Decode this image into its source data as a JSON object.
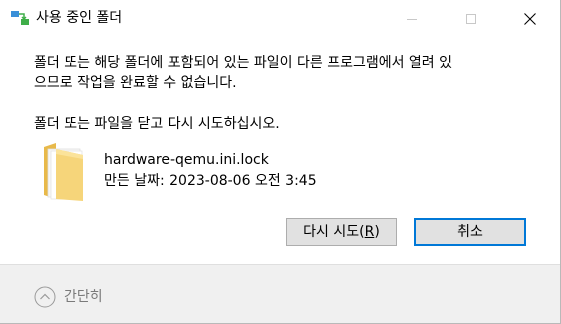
{
  "window": {
    "title": "사용 중인 폴더",
    "app_icon": "folder-move-icon",
    "controls": {
      "minimize_icon": "minimize-icon",
      "maximize_icon": "maximize-icon",
      "close_icon": "close-icon"
    }
  },
  "message": {
    "line1": "폴더 또는 해당 폴더에 포함되어 있는 파일이 다른 프로그램에서 열려 있",
    "line2": "으므로 작업을 완료할 수 없습니다.",
    "line3": "폴더 또는 파일을 닫고 다시 시도하십시오."
  },
  "file": {
    "icon": "folder-icon",
    "name": "hardware-qemu.ini.lock",
    "date": "만든 날짜: 2023-08-06 오전 3:45"
  },
  "buttons": {
    "retry_prefix": "다시 시도(",
    "retry_access_key": "R",
    "retry_suffix": ")",
    "cancel": "취소"
  },
  "footer": {
    "details_icon": "chevron-up-circle-icon",
    "details_label": "간단히"
  },
  "colors": {
    "focus_border": "#0078d7",
    "button_bg": "#e1e1e1",
    "footer_bg": "#f0f0f0",
    "muted_text": "#7a7a7a"
  }
}
